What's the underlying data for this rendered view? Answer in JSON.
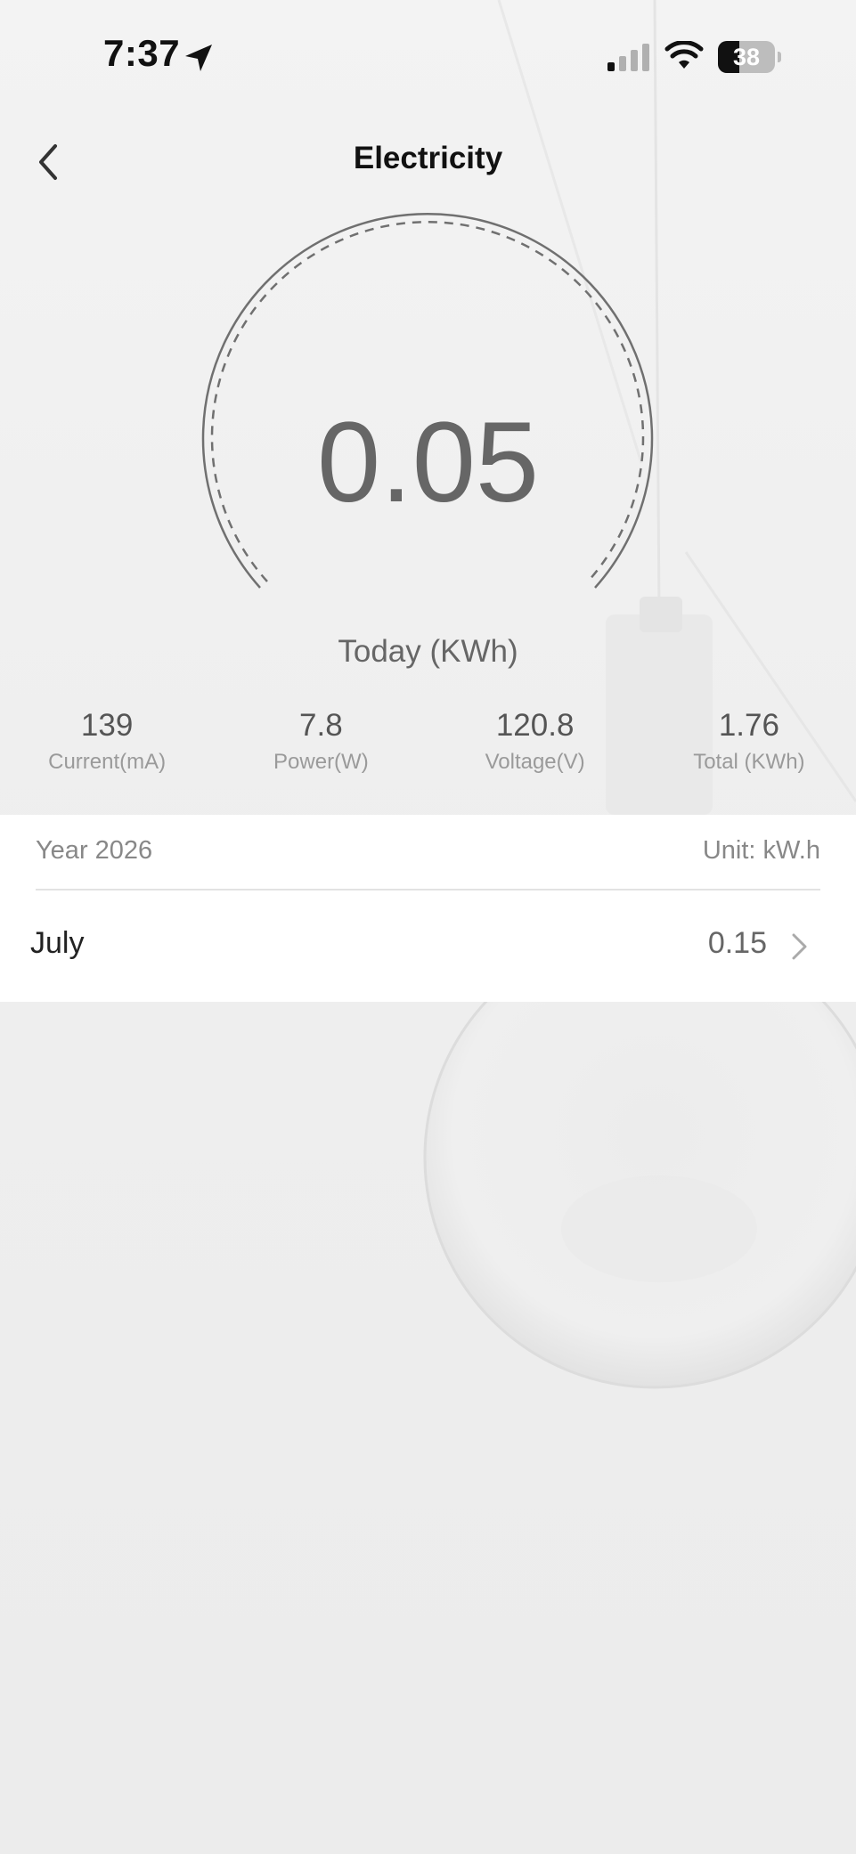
{
  "status_bar": {
    "time": "7:37",
    "battery": "38",
    "icons": [
      "location-arrow-icon",
      "cellular-signal-icon",
      "wifi-icon",
      "battery-icon"
    ]
  },
  "header": {
    "title": "Electricity",
    "back_icon": "chevron-left-icon"
  },
  "gauge": {
    "value": "0.05",
    "label": "Today (KWh)"
  },
  "metrics": [
    {
      "value": "139",
      "label": "Current(mA)"
    },
    {
      "value": "7.8",
      "label": "Power(W)"
    },
    {
      "value": "120.8",
      "label": "Voltage(V)"
    },
    {
      "value": "1.76",
      "label": "Total (KWh)"
    }
  ],
  "year_card": {
    "title": "Year 2026",
    "unit": "Unit: kW.h",
    "months": [
      {
        "name": "July",
        "value": "0.15",
        "icon": "chevron-right-icon"
      }
    ]
  },
  "colors": {
    "background": "#efefef",
    "card": "#ffffff",
    "title_text": "#111111",
    "muted_text": "#888888"
  }
}
